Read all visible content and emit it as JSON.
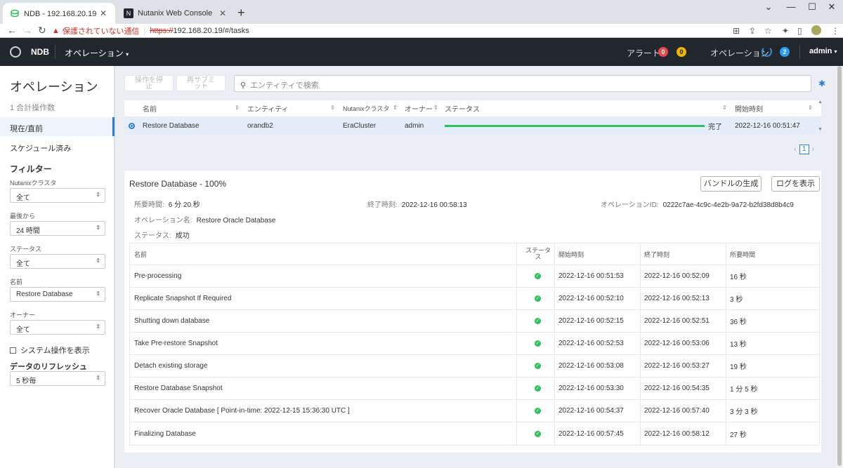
{
  "browser": {
    "tabs": [
      {
        "title": "NDB - 192.168.20.19 - オペレーション",
        "active": true
      },
      {
        "title": "Nutanix Web Console",
        "active": false
      }
    ],
    "security_warning": "保護されていない通信",
    "url_scheme": "https://",
    "url_rest": "192.168.20.19/#/tasks"
  },
  "header": {
    "brand": "NDB",
    "menu": "オペレーション",
    "alerts_label": "アラート",
    "alert_red_count": "0",
    "alert_yellow_count": "0",
    "ops_label": "オペレーション",
    "ops_count": "2",
    "user": "admin"
  },
  "sidebar": {
    "title": "オペレーション",
    "count": "1 合計操作数",
    "nav_current": "現在/直前",
    "nav_scheduled": "スケジュール済み",
    "filter_title": "フィルター",
    "filters": [
      {
        "label": "Nutanixクラスタ",
        "value": "全て"
      },
      {
        "label": "最後から",
        "value": "24 時間"
      },
      {
        "label": "ステータス",
        "value": "全て"
      },
      {
        "label": "名前",
        "value": "Restore Database"
      },
      {
        "label": "オーナー",
        "value": "全て"
      }
    ],
    "system_ops": "システム操作を表示",
    "refresh_title": "データのリフレッシュ",
    "refresh_value": "5 秒毎"
  },
  "toolbar": {
    "stop_label_1": "操作を停",
    "stop_label_2": "止",
    "resubmit_label_1": "再サブミ",
    "resubmit_label_2": "ット",
    "search_placeholder": "エンティティで検索"
  },
  "ops_table": {
    "headers": {
      "name": "名前",
      "entity": "エンティティ",
      "cluster": "Nutanixクラスタ",
      "owner": "オーナー",
      "status": "ステータス",
      "start": "開始時刻"
    },
    "row": {
      "name": "Restore Database",
      "entity": "orandb2",
      "cluster": "EraCluster",
      "owner": "admin",
      "progress": 1.0,
      "status": "完了",
      "start": "2022-12-16 00:51:47"
    },
    "page": "1"
  },
  "detail": {
    "title": "Restore Database - 100%",
    "btn_bundle": "バンドルの生成",
    "btn_logs": "ログを表示",
    "duration_label": "所要時間:",
    "duration_value": "6 分 20 秒",
    "end_label": "終了時刻:",
    "end_value": "2022-12-16 00:58:13",
    "opid_label": "オペレーションID:",
    "opid_value": "0222c7ae-4c9c-4e2b-9a72-b2fd38d8b4c9",
    "opname_label": "オペレーション名:",
    "opname_value": "Restore Oracle Database",
    "status_label": "ステータス:",
    "status_value": "成功",
    "steps_headers": {
      "name": "名前",
      "status_1": "ステータ",
      "status_2": "ス",
      "start": "開始時刻",
      "end": "終了時刻",
      "duration": "所要時間"
    },
    "steps": [
      {
        "name": "Pre-processing",
        "start": "2022-12-16 00:51:53",
        "end": "2022-12-16 00:52:09",
        "duration": "16 秒"
      },
      {
        "name": "Replicate Snapshot If Required",
        "start": "2022-12-16 00:52:10",
        "end": "2022-12-16 00:52:13",
        "duration": "3 秒"
      },
      {
        "name": "Shutting down database",
        "start": "2022-12-16 00:52:15",
        "end": "2022-12-16 00:52:51",
        "duration": "36 秒"
      },
      {
        "name": "Take Pre-restore Snapshot",
        "start": "2022-12-16 00:52:53",
        "end": "2022-12-16 00:53:06",
        "duration": "13 秒"
      },
      {
        "name": "Detach existing storage",
        "start": "2022-12-16 00:53:08",
        "end": "2022-12-16 00:53:27",
        "duration": "19 秒"
      },
      {
        "name": "Restore Database Snapshot",
        "start": "2022-12-16 00:53:30",
        "end": "2022-12-16 00:54:35",
        "duration": "1 分 5 秒"
      },
      {
        "name": "Recover Oracle Database [ Point-in-time: 2022-12-15 15:36:30 UTC ]",
        "start": "2022-12-16 00:54:37",
        "end": "2022-12-16 00:57:40",
        "duration": "3 分 3 秒"
      },
      {
        "name": "Finalizing Database",
        "start": "2022-12-16 00:57:45",
        "end": "2022-12-16 00:58:12",
        "duration": "27 秒"
      }
    ]
  },
  "colors": {
    "accent": "#2a7fd4",
    "success": "#2fbf5b",
    "header_bg": "#22272e",
    "alert_red": "#e5484d",
    "alert_yellow": "#f0b400"
  }
}
